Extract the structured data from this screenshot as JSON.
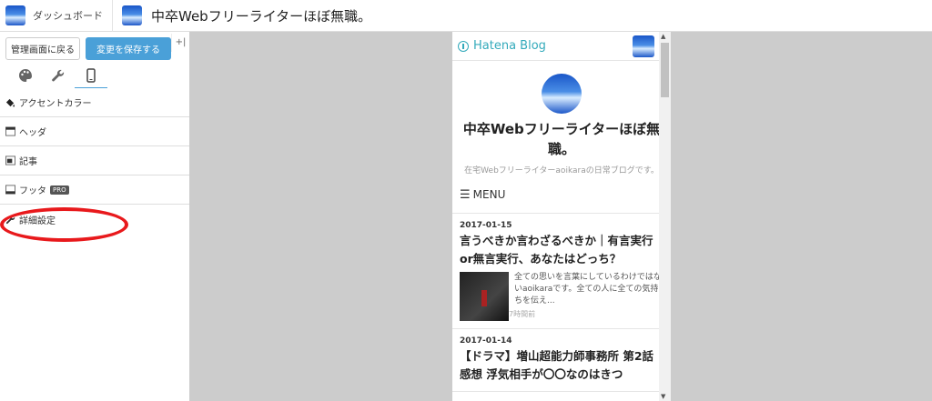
{
  "topbar": {
    "dashboard_label": "ダッシュボード",
    "blog_title": "中卒Webフリーライターほぼ無職。"
  },
  "panel": {
    "back_label": "管理画面に戻る",
    "save_label": "変更を保存する",
    "collapse_icon": "collapse-sidebar-icon",
    "tabs": [
      {
        "icon": "palette-icon"
      },
      {
        "icon": "wrench-icon"
      },
      {
        "icon": "smartphone-icon",
        "active": true
      }
    ],
    "menu": [
      {
        "label": "アクセントカラー",
        "icon": "paint-bucket-icon"
      },
      {
        "label": "ヘッダ",
        "icon": "header-layout-icon"
      },
      {
        "label": "記事",
        "icon": "article-layout-icon"
      },
      {
        "label": "フッタ",
        "icon": "footer-layout-icon",
        "badge": "PRO"
      },
      {
        "label": "詳細設定",
        "icon": "wrench-icon"
      }
    ],
    "highlight_color": "#e8191c",
    "accent_color": "#4aa0d8"
  },
  "preview": {
    "brand": "Hatena Blog",
    "brand_color": "#33aabb",
    "title": "中卒Webフリーライターほぼ無職。",
    "description": "在宅Webフリーライターaoikaraの日常ブログです。",
    "menu_label": "MENU",
    "entries": [
      {
        "date": "2017-01-15",
        "title": "言うべきか言わざるべきか｜有言実行or無言実行、あなたはどっち？",
        "excerpt": "全ての思いを言葉にしているわけではないaoikaraです。全ての人に全ての気持ちを伝え...",
        "ago": "7時間前"
      },
      {
        "date": "2017-01-14",
        "title": "【ドラマ】増山超能力師事務所 第2話 感想 浮気相手が〇〇なのはきつ"
      }
    ]
  }
}
